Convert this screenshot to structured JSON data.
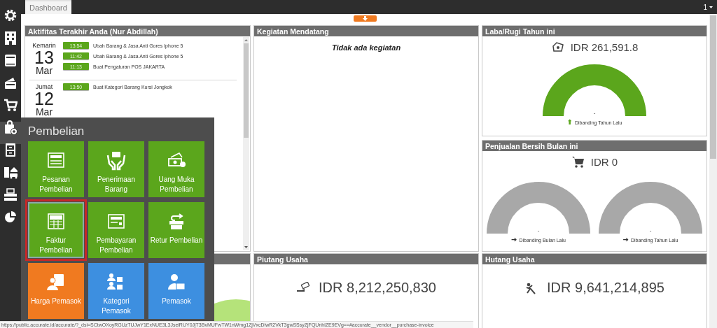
{
  "top_bar": {
    "tabs": [
      {
        "label": "Dashboard",
        "selected": true
      }
    ],
    "user_menu": "1"
  },
  "sidebar": {
    "items": [
      {
        "selected": false
      },
      {
        "selected": false
      },
      {
        "selected": false
      },
      {
        "selected": false
      },
      {
        "selected": false
      },
      {
        "selected": true
      },
      {
        "selected": false
      },
      {
        "selected": false
      },
      {
        "selected": false
      },
      {
        "selected": false
      }
    ]
  },
  "activity": {
    "title": "Aktifitas Terakhir Anda (Nur Abdillah)",
    "groups": [
      {
        "day": "Kemarin",
        "date": "13",
        "month": "Mar",
        "entries": [
          {
            "time": "13:54",
            "text": "Ubah Barang & Jasa Anti Gores Iphone 5"
          },
          {
            "time": "11:42",
            "text": "Ubah Barang & Jasa Anti Gores Iphone 5"
          },
          {
            "time": "11:13",
            "text": "Buat Pengaturan POS JAKARTA"
          }
        ]
      },
      {
        "day": "Jumat",
        "date": "12",
        "month": "Mar",
        "entries": [
          {
            "time": "13:50",
            "text": "Buat Kategori Barang Kursi Jongkok"
          }
        ]
      }
    ]
  },
  "upcoming": {
    "title": "Kegiatan Mendatang",
    "empty_text": "Tidak ada kegiatan"
  },
  "profit": {
    "title": "Laba/Rugi Tahun ini",
    "amount": "IDR 261,591.8",
    "gauges": [
      {
        "color": "#5ba61c",
        "value": "-",
        "trend": {
          "arrow": "⬆",
          "color": "#5ba61c"
        },
        "caption": "Dibanding Tahun Lalu"
      }
    ]
  },
  "net_sales": {
    "title": "Penjualan Bersih Bulan ini",
    "amount": "IDR 0",
    "gauges": [
      {
        "color": "#a8a8a8",
        "value": "-",
        "trend": {
          "arrow": "➔",
          "color": "#333333"
        },
        "caption": "Dibanding Bulan Lalu"
      },
      {
        "color": "#a8a8a8",
        "value": "-",
        "trend": {
          "arrow": "➔",
          "color": "#333333"
        },
        "caption": "Dibanding Tahun Lalu"
      }
    ]
  },
  "receivables": {
    "title": "Piutang Usaha",
    "amount": "IDR 8,212,250,830"
  },
  "payables": {
    "title": "Hutang Usaha",
    "amount": "IDR 9,641,214,895"
  },
  "purchase_menu": {
    "title": "Pembelian",
    "tiles": [
      {
        "label": "Pesanan\nPembelian",
        "color": "#5ba61c",
        "selected": false
      },
      {
        "label": "Penerimaan\nBarang",
        "color": "#5ba61c",
        "selected": false
      },
      {
        "label": "Uang Muka\nPembelian",
        "color": "#5ba61c",
        "selected": false
      },
      {
        "label": "Faktur\nPembelian",
        "color": "#5ba61c",
        "selected": true
      },
      {
        "label": "Pembayaran\nPembelian",
        "color": "#5ba61c",
        "selected": false
      },
      {
        "label": "Retur Pembelian",
        "color": "#5ba61c",
        "selected": false
      },
      {
        "label": "Harga Pemasok",
        "color": "#f07a20",
        "selected": false
      },
      {
        "label": "Kategori\nPemasok",
        "color": "#3d8fe0",
        "selected": false
      },
      {
        "label": "Pemasok",
        "color": "#3d8fe0",
        "selected": false
      }
    ]
  },
  "status_bar": {
    "url": "https://public.accurate.id/accurate/?_dsi=SCtwOXoyRGUzTUJwY1ExNUE3L3JseiRUY0JjT3BvMUFwTW1nWmg1ZjVxcDlwR2VkT3gwSSsyZjFQUnhiZE9EVg==#accurate__vendor__purchase-invoice"
  }
}
